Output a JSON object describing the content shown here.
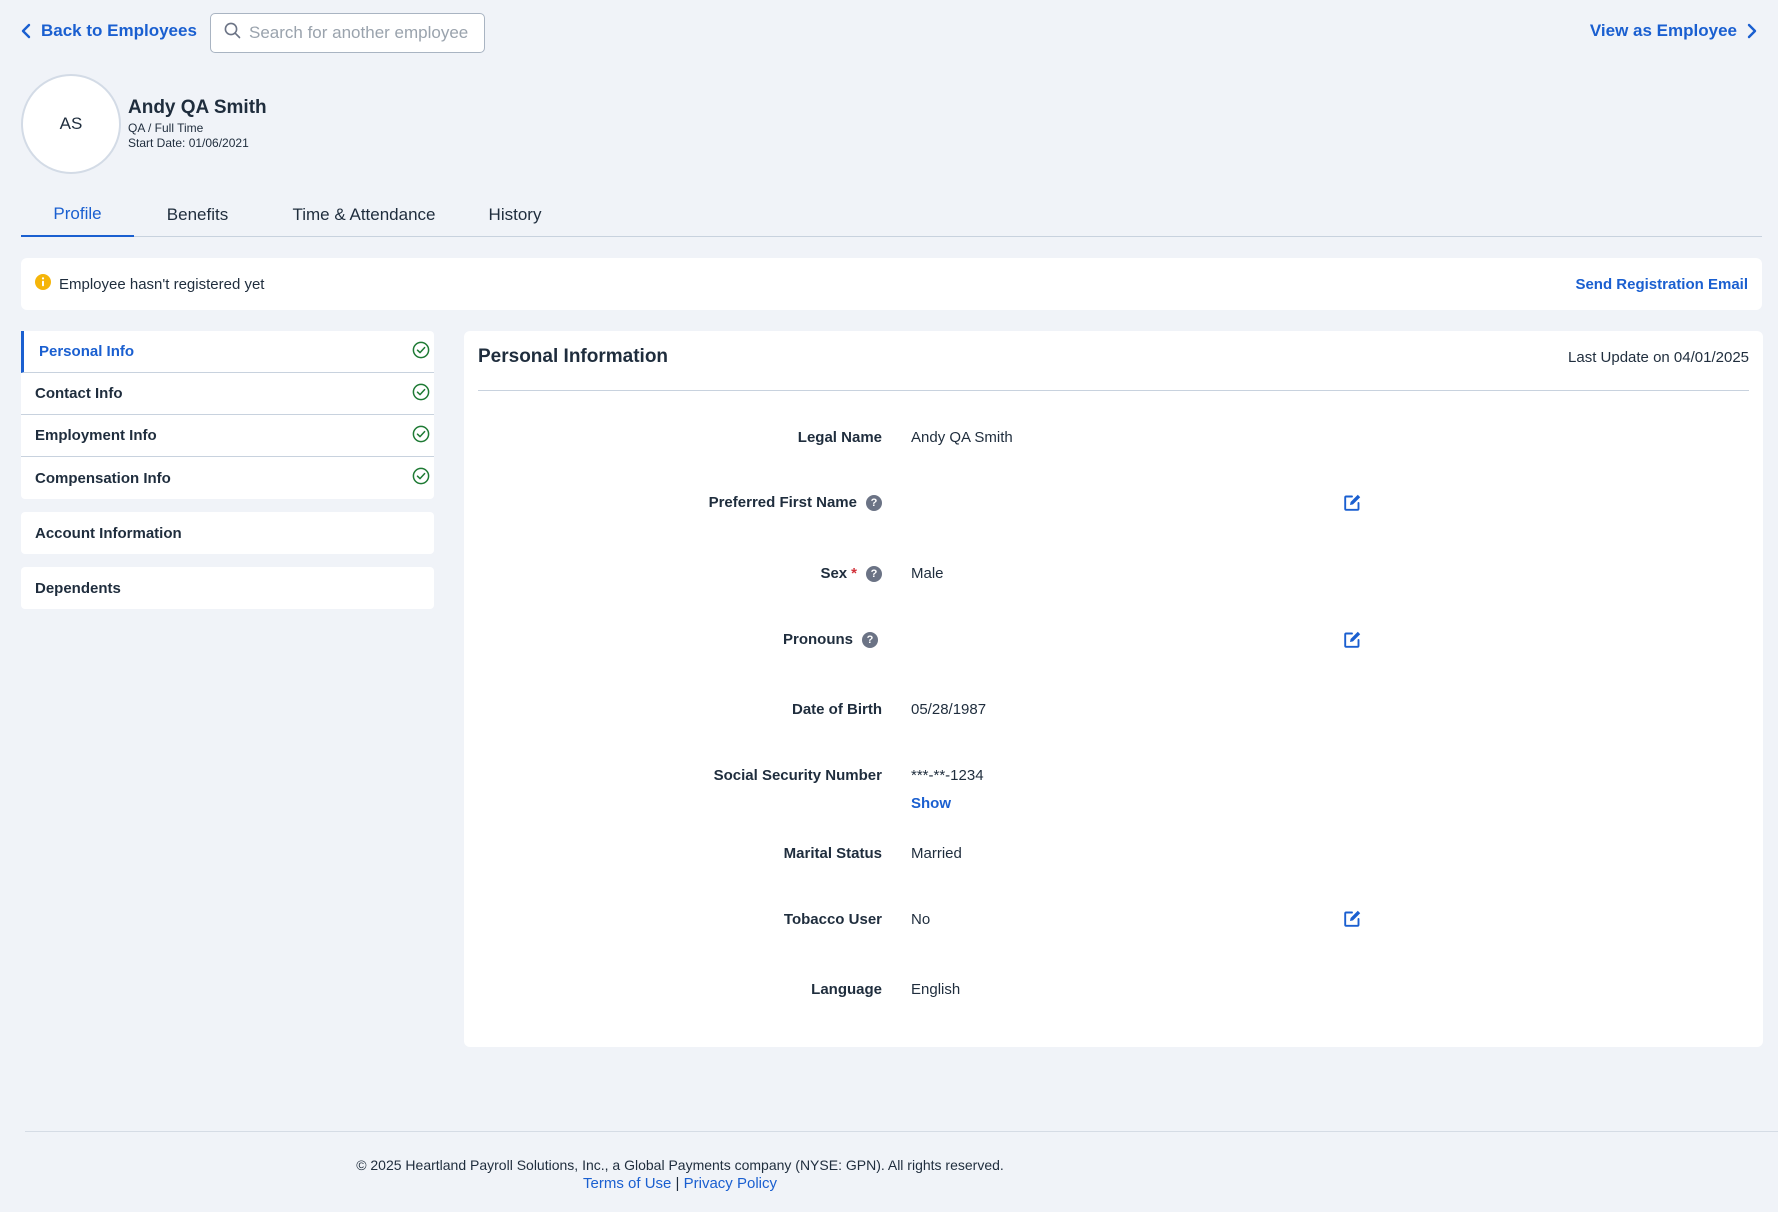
{
  "topbar": {
    "back_label": "Back to Employees",
    "search_placeholder": "Search for another employee",
    "view_as_label": "View as Employee"
  },
  "employee": {
    "initials": "AS",
    "name": "Andy QA Smith",
    "role": "QA / Full Time",
    "start_date": "Start Date: 01/06/2021"
  },
  "tabs": [
    {
      "label": "Profile",
      "active": true
    },
    {
      "label": "Benefits",
      "active": false
    },
    {
      "label": "Time & Attendance",
      "active": false
    },
    {
      "label": "History",
      "active": false
    }
  ],
  "notice": {
    "text": "Employee hasn't registered yet",
    "action": "Send Registration Email"
  },
  "sidenav": {
    "group1": [
      {
        "label": "Personal Info",
        "complete": true,
        "active": true
      },
      {
        "label": "Contact Info",
        "complete": true
      },
      {
        "label": "Employment Info",
        "complete": true
      },
      {
        "label": "Compensation Info",
        "complete": true
      }
    ],
    "account": "Account Information",
    "dependents": "Dependents"
  },
  "personal": {
    "title": "Personal Information",
    "last_update": "Last Update on 04/01/2025",
    "fields": {
      "legal_name": {
        "label": "Legal Name",
        "value": "Andy QA Smith"
      },
      "preferred_first_name": {
        "label": "Preferred First Name",
        "value": ""
      },
      "sex": {
        "label": "Sex",
        "required": "*",
        "value": "Male"
      },
      "pronouns": {
        "label": "Pronouns",
        "value": ""
      },
      "dob": {
        "label": "Date of Birth",
        "value": "05/28/1987"
      },
      "ssn": {
        "label": "Social Security Number",
        "value": "***-**-1234",
        "show_label": "Show"
      },
      "marital": {
        "label": "Marital Status",
        "value": "Married"
      },
      "tobacco": {
        "label": "Tobacco User",
        "value": "No"
      },
      "language": {
        "label": "Language",
        "value": "English"
      }
    },
    "help_glyph": "?"
  },
  "footer": {
    "copyright": "© 2025 Heartland Payroll Solutions, Inc., a Global Payments company (NYSE: GPN). All rights reserved.",
    "terms": "Terms of Use",
    "separator": "|",
    "privacy": "Privacy Policy"
  },
  "colors": {
    "accent": "#1a5fd0",
    "background": "#f0f3f8",
    "success": "#1e7a34",
    "warning": "#f5b50a",
    "required": "#d2313a"
  },
  "icons": [
    "chevron-left-icon",
    "search-icon",
    "chevron-right-icon",
    "info-icon",
    "check-circle-icon",
    "help-icon",
    "edit-icon"
  ]
}
